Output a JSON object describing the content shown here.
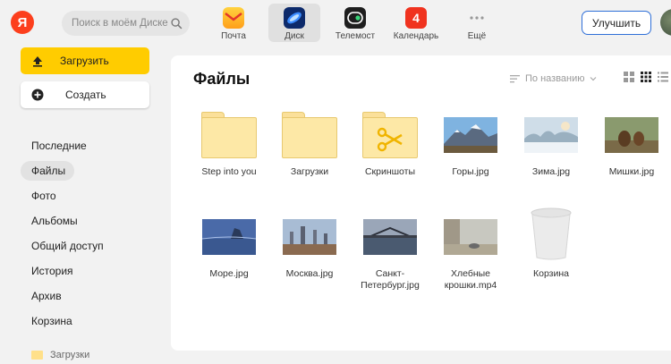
{
  "header": {
    "logo": "Я",
    "search_placeholder": "Поиск в моём Диске",
    "apps": [
      {
        "label": "Почта",
        "icon": "mail-icon"
      },
      {
        "label": "Диск",
        "icon": "disk-icon"
      },
      {
        "label": "Телемост",
        "icon": "telemost-icon"
      },
      {
        "label": "Календарь",
        "icon": "calendar-icon",
        "badge": "4"
      },
      {
        "label": "Ещё",
        "icon": "more-icon"
      }
    ],
    "upgrade_label": "Улучшить"
  },
  "sidebar": {
    "upload_label": "Загрузить",
    "create_label": "Создать",
    "items": [
      {
        "label": "Последние"
      },
      {
        "label": "Файлы"
      },
      {
        "label": "Фото"
      },
      {
        "label": "Альбомы"
      },
      {
        "label": "Общий доступ"
      },
      {
        "label": "История"
      },
      {
        "label": "Архив"
      },
      {
        "label": "Корзина"
      }
    ],
    "active_item": "Файлы",
    "pinned_folder": "Загрузки"
  },
  "main": {
    "title": "Файлы",
    "sort_label": "По названию",
    "files": [
      {
        "name": "Step into you",
        "type": "folder"
      },
      {
        "name": "Загрузки",
        "type": "folder"
      },
      {
        "name": "Скриншоты",
        "type": "folder-screenshots"
      },
      {
        "name": "Горы.jpg",
        "type": "image"
      },
      {
        "name": "Зима.jpg",
        "type": "image"
      },
      {
        "name": "Мишки.jpg",
        "type": "image"
      },
      {
        "name": "Море.jpg",
        "type": "image"
      },
      {
        "name": "Москва.jpg",
        "type": "image"
      },
      {
        "name": "Санкт-Петербург.jpg",
        "type": "image"
      },
      {
        "name": "Хлебные крошки.mp4",
        "type": "video"
      },
      {
        "name": "Корзина",
        "type": "trash"
      }
    ]
  },
  "colors": {
    "accent_yellow": "#ffcc00",
    "brand_red": "#fc3f1d",
    "upgrade_border": "#2f6fd8",
    "folder": "#fde8a6"
  }
}
